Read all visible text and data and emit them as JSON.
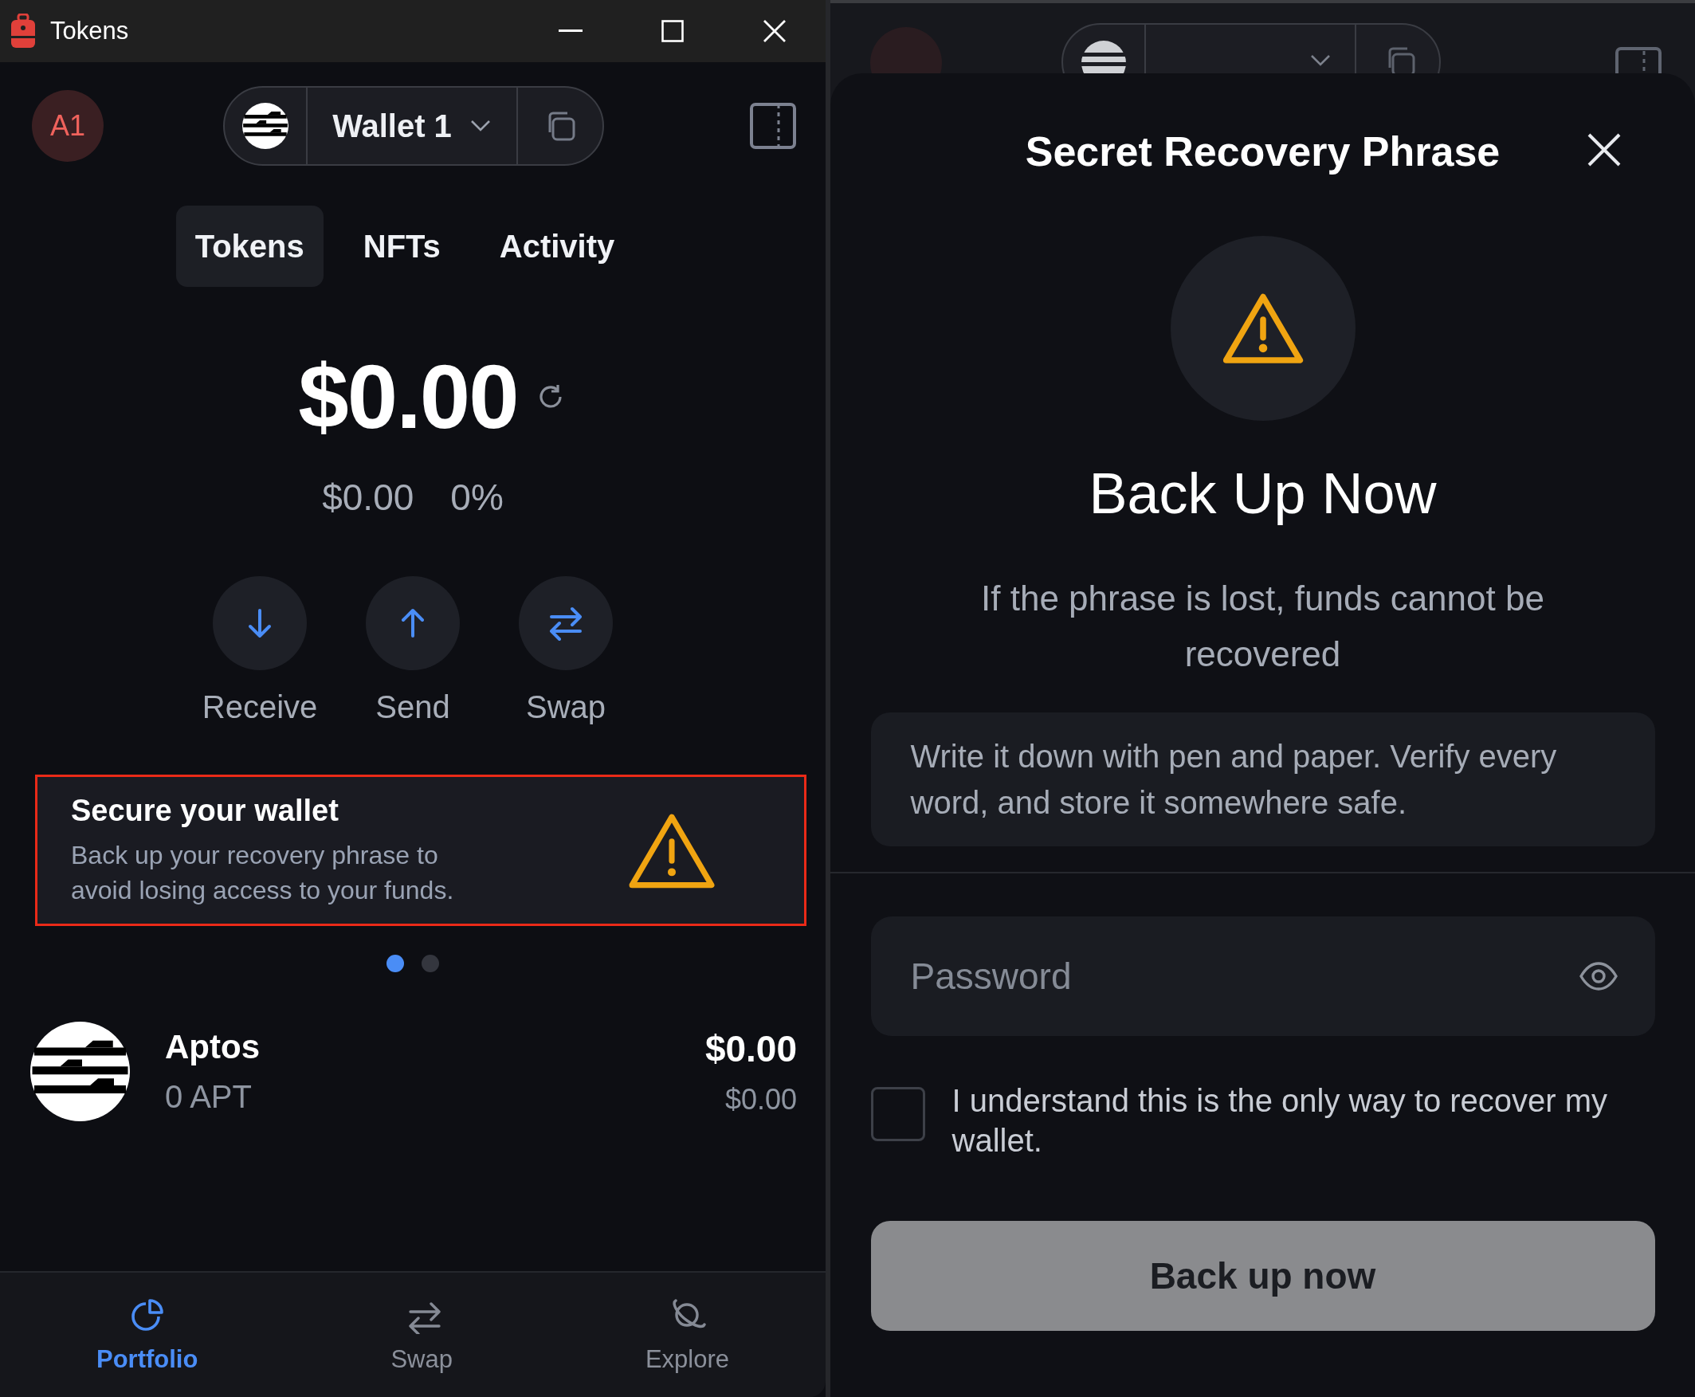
{
  "window": {
    "title": "Tokens"
  },
  "header": {
    "avatar": "A1",
    "wallet": "Wallet 1"
  },
  "tabs": [
    {
      "label": "Tokens",
      "selected": true
    },
    {
      "label": "NFTs",
      "selected": false
    },
    {
      "label": "Activity",
      "selected": false
    }
  ],
  "balance": {
    "amount": "$0.00",
    "change_value": "$0.00",
    "change_percent": "0%"
  },
  "actions": [
    {
      "kind": "receive",
      "label": "Receive"
    },
    {
      "kind": "send",
      "label": "Send"
    },
    {
      "kind": "swap",
      "label": "Swap"
    }
  ],
  "banner": {
    "title": "Secure your wallet",
    "text": "Back up your recovery phrase to avoid losing access to your funds.",
    "highlighted": true
  },
  "carousel": [
    {
      "selected": true
    },
    {
      "selected": false
    }
  ],
  "tokens": [
    {
      "name": "Aptos",
      "amount": "0 APT",
      "value": "$0.00",
      "fiat": "$0.00"
    }
  ],
  "bottom_nav": [
    {
      "kind": "portfolio",
      "label": "Portfolio",
      "selected": true
    },
    {
      "kind": "swap",
      "label": "Swap",
      "selected": false
    },
    {
      "kind": "explore",
      "label": "Explore",
      "selected": false
    }
  ],
  "sheet": {
    "title": "Secret Recovery Phrase",
    "heading": "Back Up Now",
    "message": "If the phrase is lost, funds cannot be recovered",
    "note": "Write it down with pen and paper. Verify every word, and store it somewhere safe.",
    "password": {
      "placeholder": "Password"
    },
    "acknowledge": {
      "label": "I understand this is the only way to recover my wallet.",
      "checked": false
    },
    "button": {
      "label": "Back up now",
      "disabled": true
    }
  }
}
